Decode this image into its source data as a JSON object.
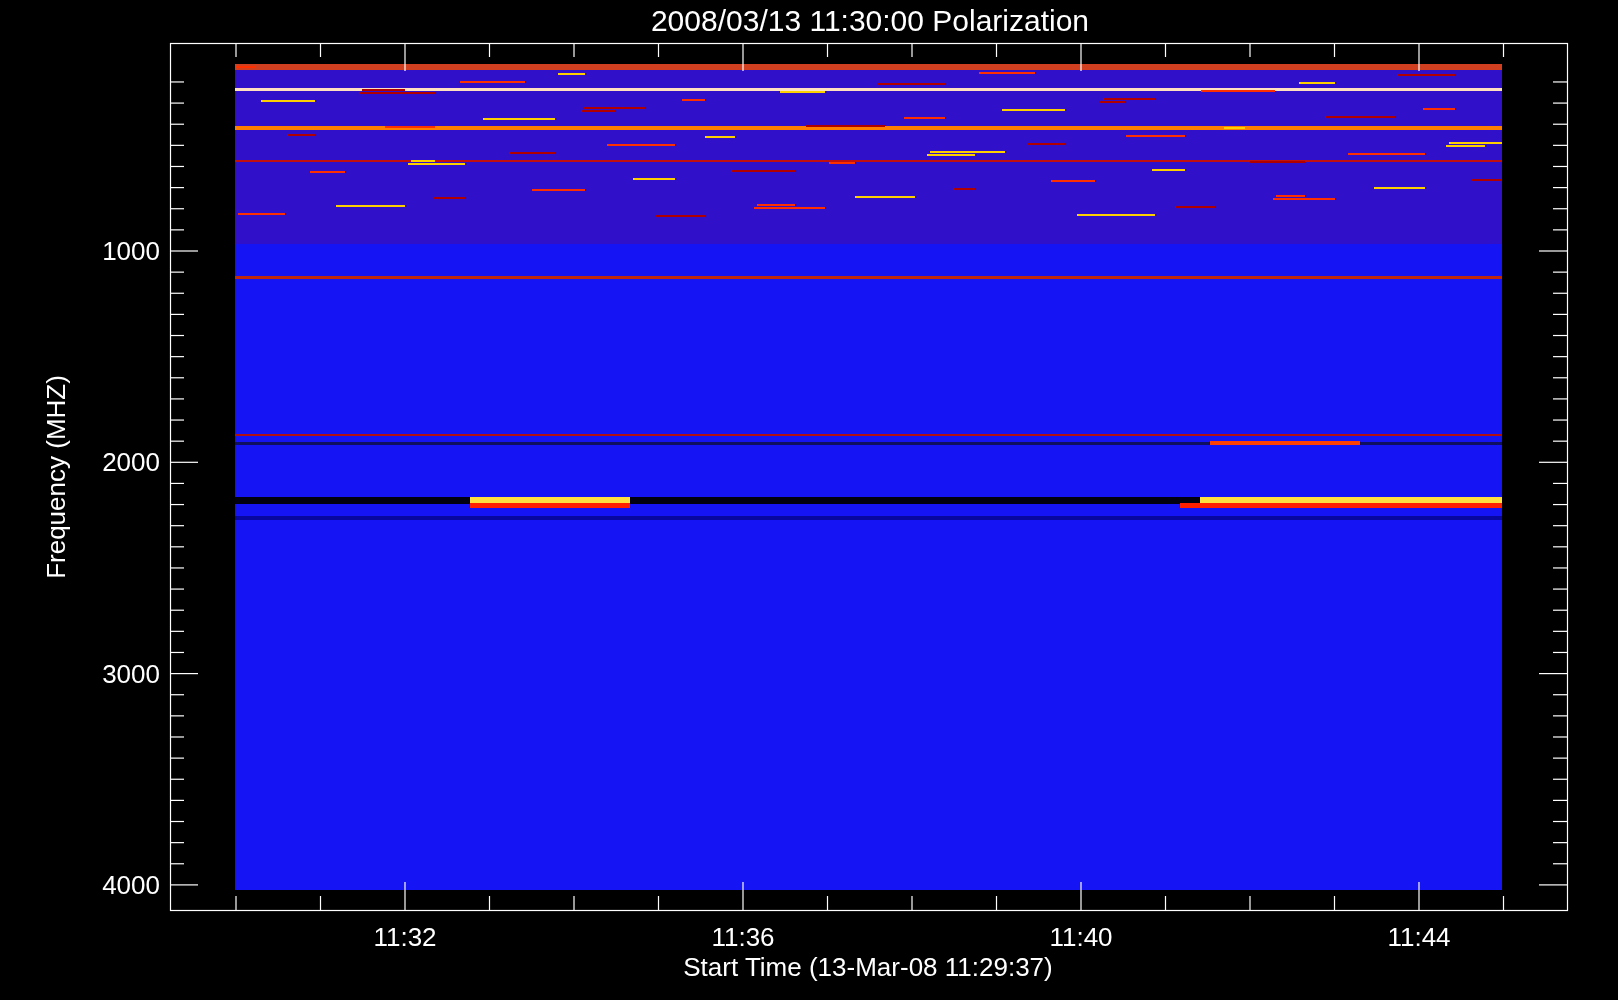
{
  "title": "2008/03/13 11:30:00 Polarization",
  "xlabel": "Start Time (13-Mar-08 11:29:37)",
  "ylabel": "Frequency (MHZ)",
  "xtick_labels": [
    "11:32",
    "11:36",
    "11:40",
    "11:44"
  ],
  "ytick_labels": [
    "1000",
    "2000",
    "3000",
    "4000"
  ]
}
